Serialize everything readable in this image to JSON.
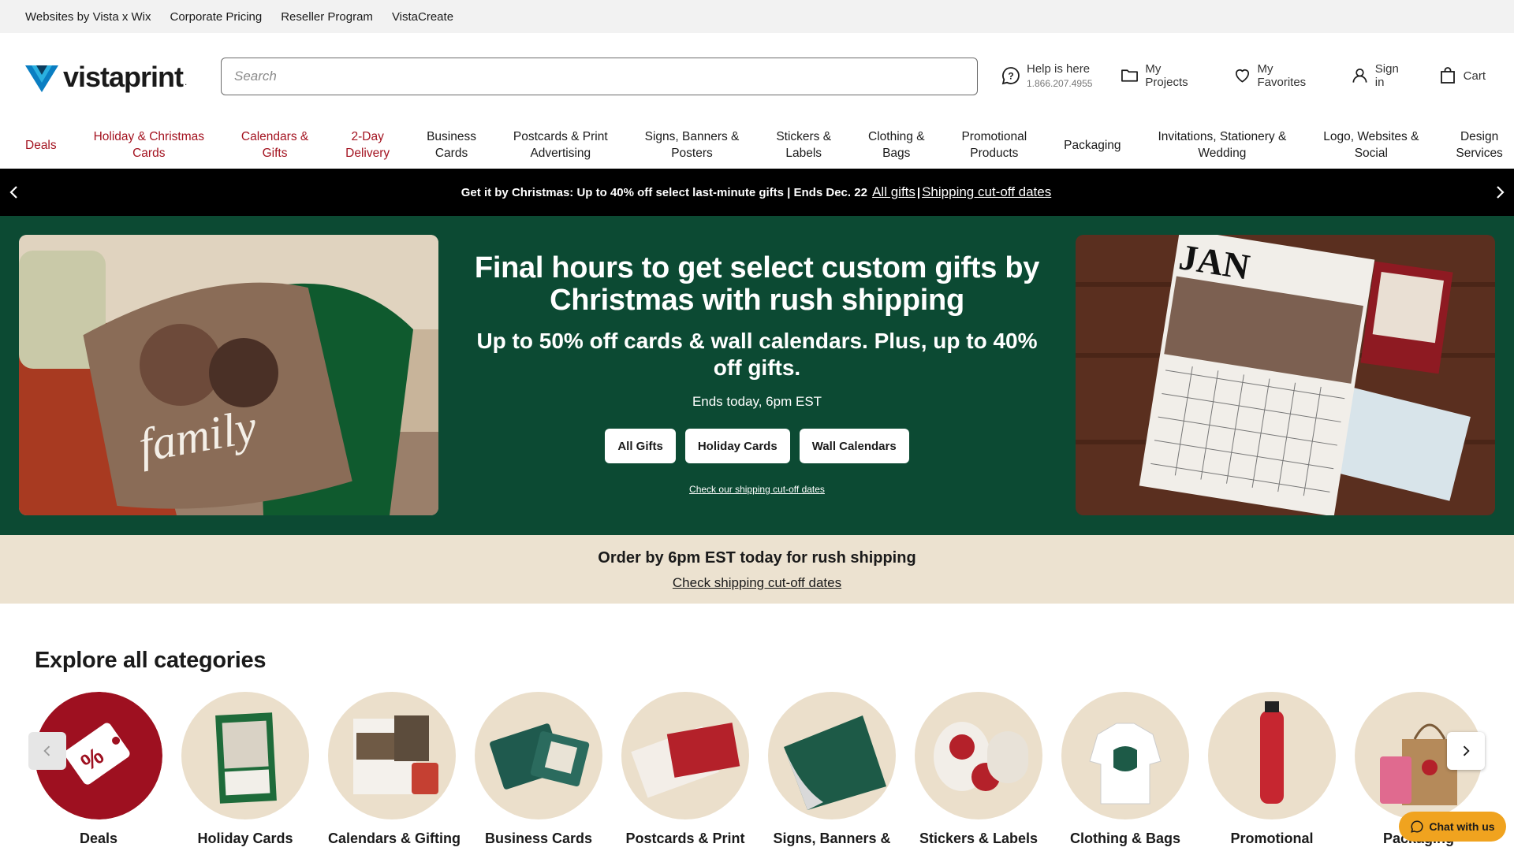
{
  "topbar": [
    "Websites by Vista x Wix",
    "Corporate Pricing",
    "Reseller Program",
    "VistaCreate"
  ],
  "logo": {
    "name": "vistaprint",
    "reg": "."
  },
  "search": {
    "placeholder": "Search"
  },
  "header": {
    "help_title": "Help is here",
    "help_phone": "1.866.207.4955",
    "my_projects": "My Projects",
    "my_favorites": "My Favorites",
    "sign_in": "Sign in",
    "cart": "Cart"
  },
  "nav": [
    {
      "label": "Deals",
      "red": true
    },
    {
      "label": "Holiday & Christmas\nCards",
      "red": true
    },
    {
      "label": "Calendars &\nGifts",
      "red": true
    },
    {
      "label": "2-Day\nDelivery",
      "red": true
    },
    {
      "label": "Business\nCards",
      "red": false
    },
    {
      "label": "Postcards & Print\nAdvertising",
      "red": false
    },
    {
      "label": "Signs, Banners &\nPosters",
      "red": false
    },
    {
      "label": "Stickers &\nLabels",
      "red": false
    },
    {
      "label": "Clothing &\nBags",
      "red": false
    },
    {
      "label": "Promotional\nProducts",
      "red": false
    },
    {
      "label": "Packaging",
      "red": false
    },
    {
      "label": "Invitations, Stationery &\nWedding",
      "red": false
    },
    {
      "label": "Logo, Websites &\nSocial",
      "red": false
    },
    {
      "label": "Design\nServices",
      "red": false
    }
  ],
  "promo_bar": {
    "text": "Get it by Christmas: Up to 40% off select last-minute gifts | Ends Dec. 22",
    "link1": "All gifts",
    "sep": "|",
    "link2": "Shipping cut-off dates"
  },
  "hero": {
    "title": "Final hours to get select custom gifts by Christmas with rush shipping",
    "subtitle": "Up to 50% off cards & wall calendars. Plus, up to 40% off gifts.",
    "ends": "Ends today, 6pm EST",
    "buttons": [
      "All Gifts",
      "Holiday Cards",
      "Wall Calendars"
    ],
    "link": "Check our shipping cut-off dates",
    "pillow_text": "family",
    "calendar_month": "JAN"
  },
  "notice": {
    "headline": "Order by 6pm EST today for rush shipping",
    "link": "Check shipping cut-off dates"
  },
  "explore": {
    "title": "Explore all categories",
    "categories": [
      "Deals",
      "Holiday Cards",
      "Calendars & Gifting",
      "Business Cards",
      "Postcards & Print",
      "Signs, Banners &",
      "Stickers & Labels",
      "Clothing & Bags",
      "Promotional",
      "Packaging"
    ]
  },
  "chat": {
    "label": "Chat with us"
  },
  "colors": {
    "brand_red": "#a3121f",
    "hero_green": "#0c4a33",
    "notice_beige": "#ece2d0",
    "chat_orange": "#f0a31f"
  }
}
